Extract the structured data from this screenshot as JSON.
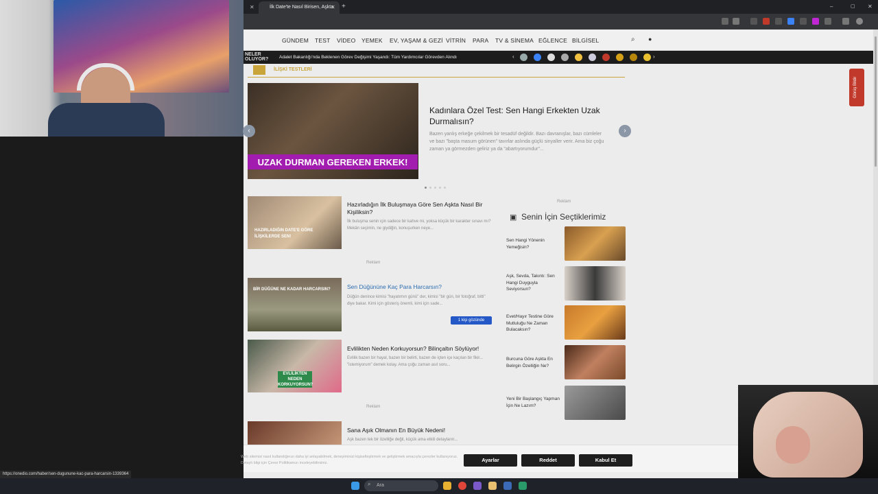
{
  "browser": {
    "tabs": [
      {
        "label": ""
      },
      {
        "label": "İlk Date'te Nasıl Birisen, Aşkta"
      }
    ],
    "new_tab": "+",
    "win_controls": {
      "min": "–",
      "max": "▢",
      "close": "✕"
    }
  },
  "site": {
    "nav": [
      "GÜNDEM",
      "TEST",
      "VİDEO",
      "YEMEK",
      "EV, YAŞAM & GEZİ",
      "VİTRİN",
      "PARA",
      "TV & SİNEMA",
      "EĞLENCE",
      "BİLGİSEL"
    ],
    "ticker_label": "NELER OLUYOR?",
    "ticker_text": "Adalet Bakanlığı'nda Beklenen Görev Değişimi Yaşandı: Tüm Yardımcılar Görevden Alındı",
    "section_title": "İLİŞKİ TESTLERİ",
    "hero": {
      "banner": "UZAK DURMAN GEREKEN ERKEK!",
      "title": "Kadınlara Özel Test: Sen Hangi Erkekten Uzak Durmalısın?",
      "desc": "Bazen yanlış erkeğe çekilmek bir tesadüf değildir. Bazı davranışlar, bazı cümleler ve bazı \"başta masum görünen\" tavırlar aslında güçlü sinyaller verir. Ama biz çoğu zaman ya görmezden geliriz ya da \"abartıyorumdur\"..."
    },
    "articles": [
      {
        "title": "Hazırladığın İlk Buluşmaya Göre Sen Aşkta Nasıl Bir Kişiliksin?",
        "desc": "İlk buluşma senin için sadece bir kahve mi, yoksa küçük bir karakter sınavı mı? Mekân seçimin, ne giydiğin, konuşurken neye...",
        "thumb_text": "HAZIRLADIĞIN DATE'E GÖRE İLİŞKİLERDE SEN!"
      },
      {
        "title": "Sen Düğününe Kaç Para Harcarsın?",
        "desc": "Düğün denince kimisi \"hayatımın günü\" der, kimisi \"bir gün, bir fotoğraf, bitti\" diye bakar. Kimi için gösteriş önemli, kimi için sade...",
        "thumb_text": "BİR DÜĞÜNE NE KADAR HARCARSIN?",
        "trend": "1 kişi gözünde"
      },
      {
        "title": "Evlilikten Neden Korkuyorsun? Bilinçaltın Söylüyor!",
        "desc": "Evlilik bazen bir hayal, bazen bir belirti, bazen de içten içe kaçılan bir fikir... \"istemiyorum\" demek kolay. Ama çoğu zaman asıl soru...",
        "thumb_text": "EVLİLİKTEN NEDEN KORKUYORSUN?"
      },
      {
        "title": "Sana Aşık Olmanın En Büyük Nedeni!",
        "desc": "Aşk bazen tek bir özelliğe değil, küçük ama etkili detayların..."
      }
    ],
    "ad_label": "Reklam",
    "sidebar": {
      "title": "Senin İçin Seçtiklerimiz",
      "items": [
        {
          "label": "Sen Hangi Yönenin Yemeğisin?"
        },
        {
          "label": "Aşk, Sevda, Takıntı: Sen Hangi Duyguyla Seviyorsun?"
        },
        {
          "label": "Evet/Hayır Testine Göre Mutluluğu Ne Zaman Bulacaksın?"
        },
        {
          "label": "Burcuna Göre Aşkta En Belirgin Özelliğin Ne?"
        },
        {
          "label": "Yeni Bir Başlangıç Yapman İçin Ne Lazım?"
        }
      ]
    },
    "feedback": "Görüş Bildir",
    "cookie": {
      "text": "Web sitemizi nasıl kullandığınızı daha iyi anlayabilmek, deneyiminizi kişiselleştirmek ve geliştirmek amacıyla çerezler kullanıyoruz. Detaylı bilgi için Çerez Politikamızı inceleyebilirsiniz.",
      "buttons": [
        "Ayarlar",
        "Reddet",
        "Kabul Et"
      ]
    },
    "status_url": "https://onedio.com/haber/sen-dugunune-kac-para-harcarsin-1339364"
  },
  "taskbar": {
    "search_placeholder": "Ara"
  },
  "colors": {
    "accent": "#c9a43a",
    "banner": "#a21caf",
    "link": "#2b6cb0"
  }
}
